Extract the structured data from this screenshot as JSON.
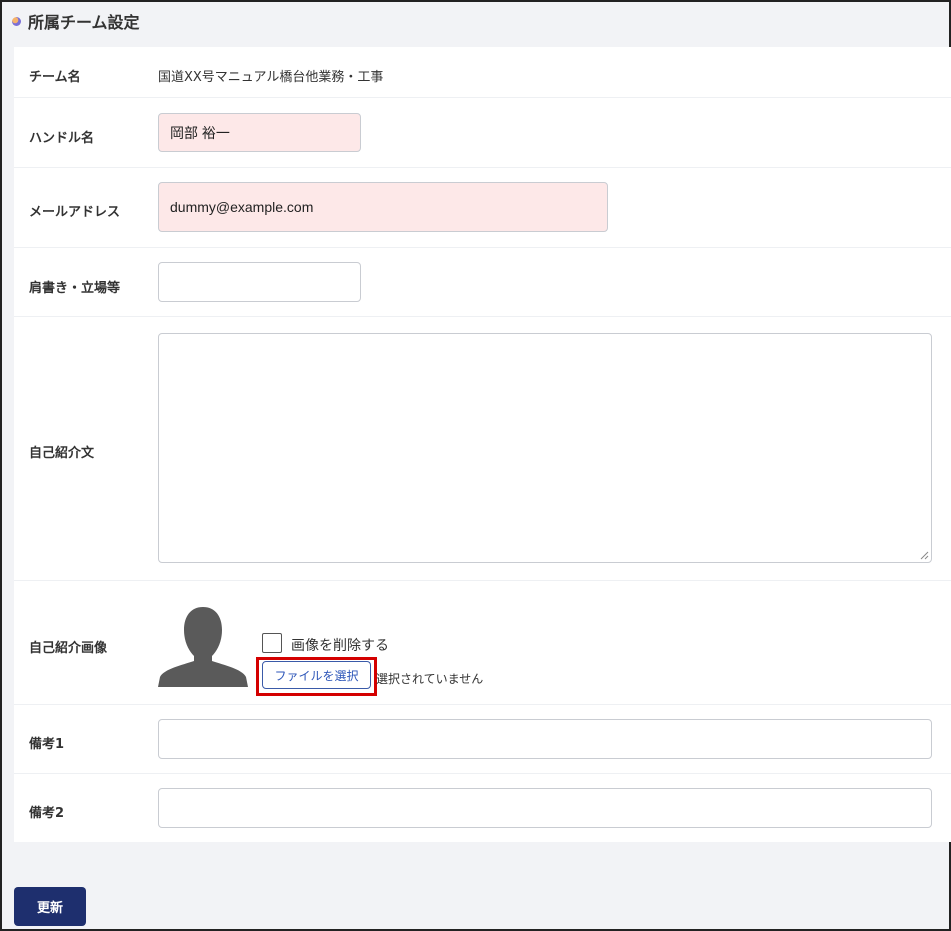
{
  "page": {
    "title": "所属チーム設定"
  },
  "form": {
    "team_name_label": "チーム名",
    "team_name_value": "国道XX号マニュアル橋台他業務・工事",
    "handle_label": "ハンドル名",
    "handle_value": "岡部 裕一",
    "email_label": "メールアドレス",
    "email_value": "dummy@example.com",
    "position_label": "肩書き・立場等",
    "position_value": "",
    "intro_label": "自己紹介文",
    "intro_value": "",
    "image_label": "自己紹介画像",
    "delete_image_label": "画像を削除する",
    "file_button_label": "ファイルを選択",
    "file_status": "選択されていません",
    "note1_label": "備考1",
    "note1_value": "",
    "note2_label": "備考2",
    "note2_value": ""
  },
  "actions": {
    "submit_label": "更新"
  },
  "colors": {
    "accent": "#1e2f6e",
    "filled_input_bg": "#fde8e8",
    "highlight": "#d40000",
    "file_button_text": "#2c55b8"
  },
  "icons": {
    "header_bullet": "bullet-dot-icon",
    "avatar": "user-silhouette-icon"
  }
}
